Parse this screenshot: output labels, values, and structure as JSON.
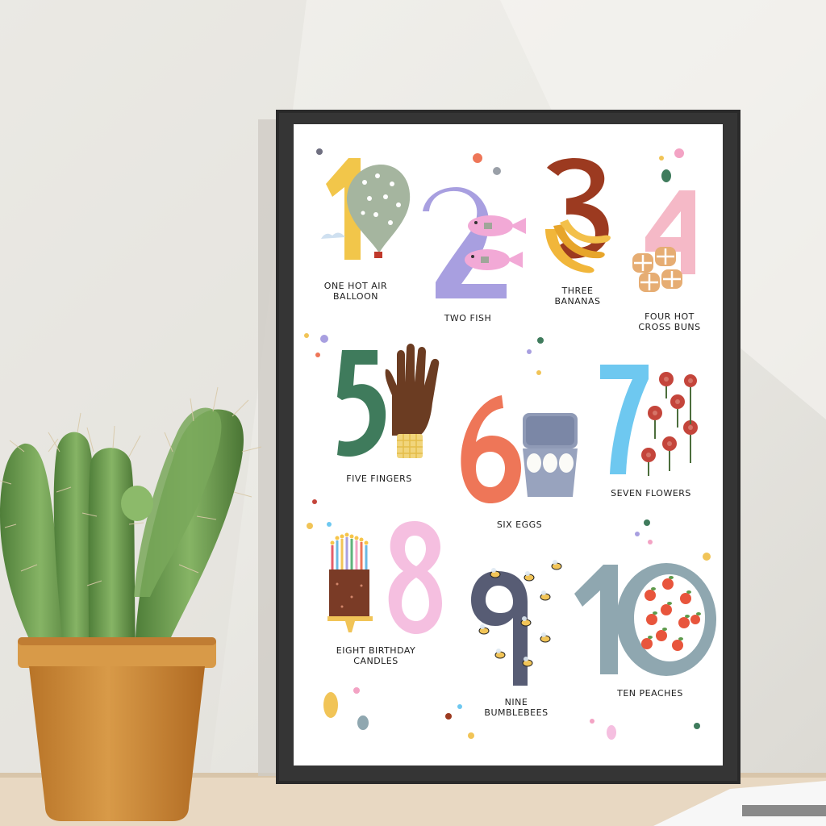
{
  "poster": {
    "items": [
      {
        "number": "1",
        "caption": "ONE HOT AIR\nBALLOON",
        "subject": "hot-air-balloon"
      },
      {
        "number": "2",
        "caption": "TWO FISH",
        "subject": "fish"
      },
      {
        "number": "3",
        "caption": "THREE\nBANANAS",
        "subject": "bananas"
      },
      {
        "number": "4",
        "caption": "FOUR HOT\nCROSS BUNS",
        "subject": "hot-cross-buns"
      },
      {
        "number": "5",
        "caption": "FIVE FINGERS",
        "subject": "hand"
      },
      {
        "number": "6",
        "caption": "SIX EGGS",
        "subject": "egg-carton"
      },
      {
        "number": "7",
        "caption": "SEVEN FLOWERS",
        "subject": "flowers"
      },
      {
        "number": "8",
        "caption": "EIGHT BIRTHDAY\nCANDLES",
        "subject": "birthday-cake"
      },
      {
        "number": "9",
        "caption": "NINE\nBUMBLEBEES",
        "subject": "bumblebees"
      },
      {
        "number": "10",
        "caption": "TEN PEACHES",
        "subject": "peaches"
      }
    ]
  },
  "colors": {
    "wall": "#ecebe6",
    "shelf": "#e6d6c0",
    "frame": "#2b2b2b",
    "paper": "#ffffff",
    "pot": "#d08f3c",
    "cactus": "#6a9a4c"
  }
}
